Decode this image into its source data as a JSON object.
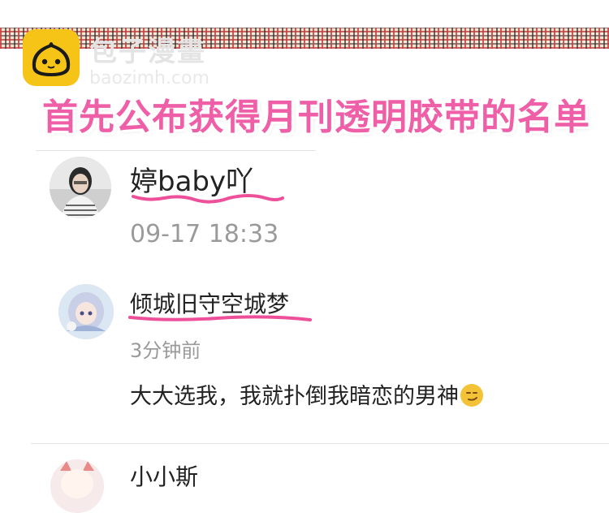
{
  "watermark": {
    "chinese": "包子漫畫",
    "english": "baozimh.com"
  },
  "banner": {
    "text": "首先公布获得月刊透明胶带的名单"
  },
  "comments": [
    {
      "username": "婷baby吖",
      "time": "09-17 18:33"
    },
    {
      "username": "倾城旧守空城梦",
      "time": "3分钟前",
      "text": "大大选我，我就扑倒我暗恋的男神"
    },
    {
      "username": "小小斯"
    }
  ],
  "colors": {
    "banner_pink": "#ef5fa7",
    "underline_pink": "#ee4f9a",
    "logo_yellow": "#f6c417",
    "time_gray": "#9a9a9a"
  },
  "icons": {
    "logo": "baozi-bun-icon",
    "emoji": "smirk-emoji-icon"
  }
}
